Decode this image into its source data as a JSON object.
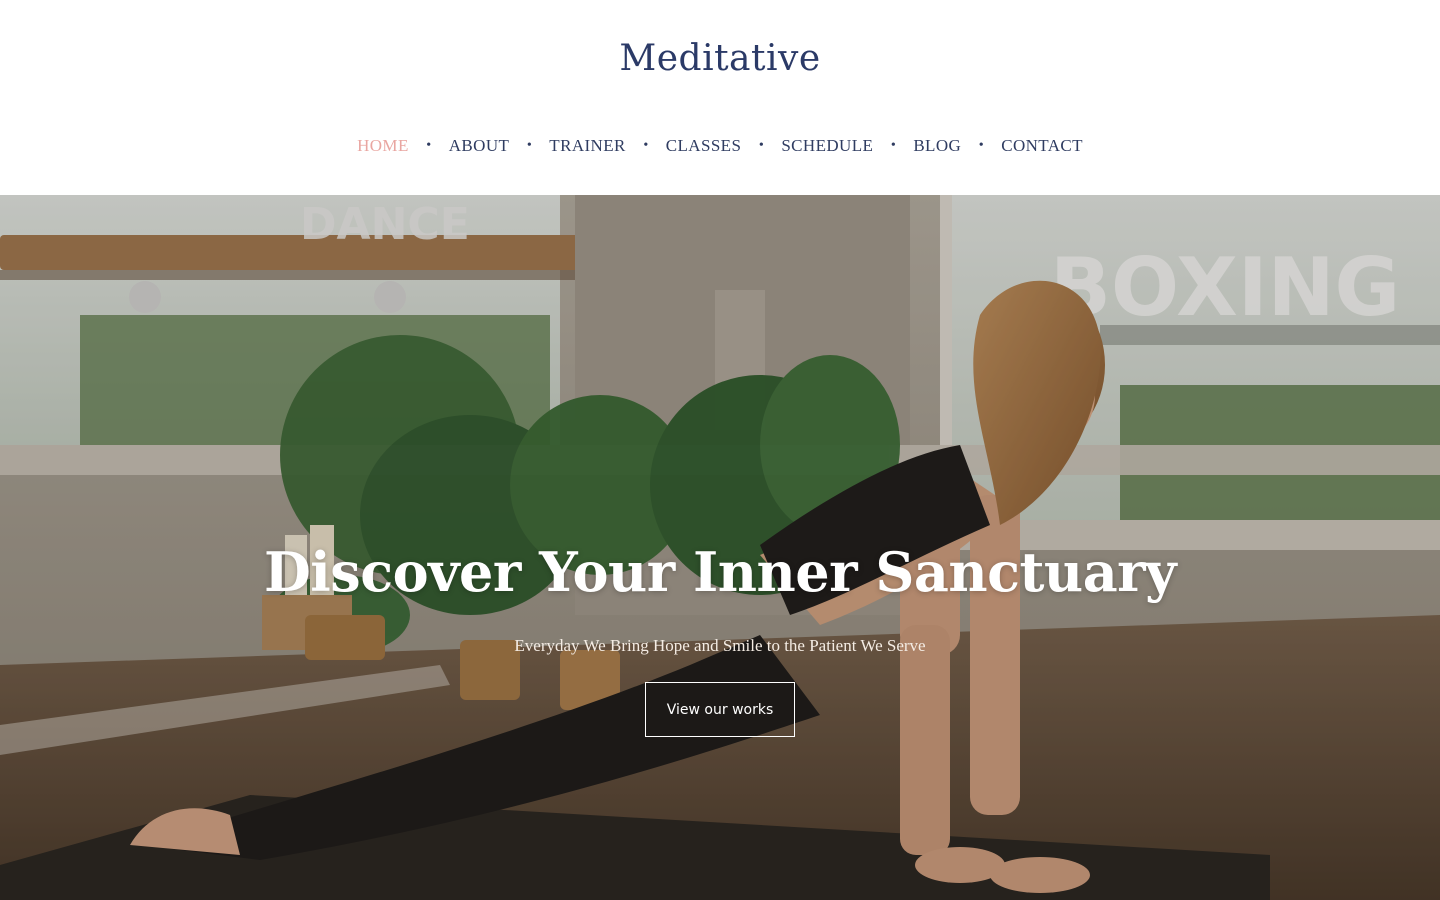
{
  "brand": {
    "name": "Meditative"
  },
  "nav": {
    "items": [
      {
        "label": "HOME",
        "active": true
      },
      {
        "label": "ABOUT",
        "active": false
      },
      {
        "label": "TRAINER",
        "active": false
      },
      {
        "label": "CLASSES",
        "active": false
      },
      {
        "label": "SCHEDULE",
        "active": false
      },
      {
        "label": "BLOG",
        "active": false
      },
      {
        "label": "CONTACT",
        "active": false
      }
    ],
    "separator": "•"
  },
  "hero": {
    "title": "Discover Your Inner Sanctuary",
    "subtitle": "Everyday We Bring Hope and Smile to the Patient We Serve",
    "button_label": "View our works",
    "window_text_1": "DANCE",
    "window_text_2": "BOXING"
  },
  "colors": {
    "brand": "#2b3a67",
    "nav_text": "#2f3c61",
    "nav_active": "#e9a6a1",
    "hero_text": "#ffffff"
  }
}
